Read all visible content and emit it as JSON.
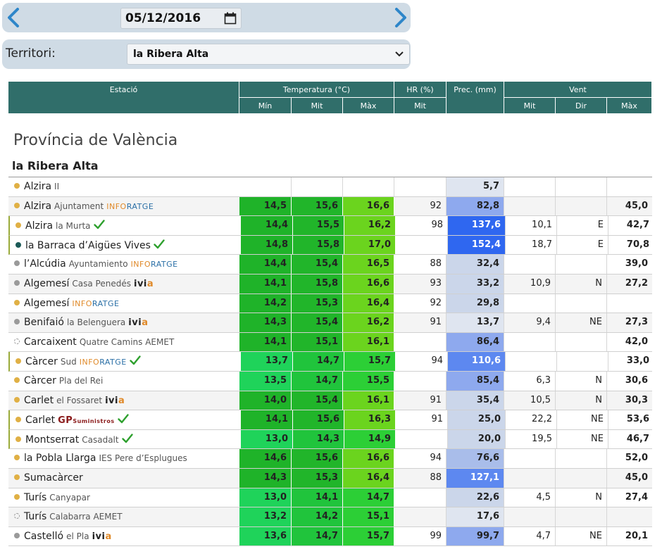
{
  "date": "05/12/2016",
  "territori": {
    "label": "Territori:",
    "selected": "la Ribera Alta"
  },
  "table_header": {
    "estacio": "Estació",
    "temperatura": "Temperatura (°C)",
    "hr": "HR (%)",
    "prec": "Prec. (mm)",
    "vent": "Vent",
    "t_min": "Mín",
    "t_mit": "Mit",
    "t_max": "Màx",
    "hr_mit": "Mit",
    "v_mit": "Mit",
    "v_dir": "Dir",
    "v_max": "Màx"
  },
  "province": "Província de València",
  "region": "la Ribera Alta",
  "colors": {
    "header_bg": "#306e6a",
    "bar_bg": "#cfdbe5",
    "prec_scale": [
      "#d7e0ef",
      "#aebfe3",
      "#7c9cec",
      "#3c74ee",
      "#1a56f0"
    ]
  },
  "rows": [
    {
      "dot": "y",
      "name": "Alzira",
      "sub": "II",
      "badge": "",
      "check": false,
      "hl": false,
      "min": "",
      "mit": "",
      "max": "",
      "hr": "",
      "prec": "5,7",
      "vmit": "",
      "vdir": "",
      "vmax": ""
    },
    {
      "dot": "y",
      "name": "Alzira",
      "sub": "Ajuntament",
      "badge": "info",
      "check": false,
      "hl": false,
      "min": "14,5",
      "mit": "15,6",
      "max": "16,6",
      "hr": "92",
      "prec": "82,8",
      "vmit": "",
      "vdir": "",
      "vmax": "45,0"
    },
    {
      "dot": "y",
      "name": "Alzira",
      "sub": "la Murta",
      "badge": "",
      "check": true,
      "hl": true,
      "min": "14,4",
      "mit": "15,5",
      "max": "16,2",
      "hr": "98",
      "prec": "137,6",
      "vmit": "10,1",
      "vdir": "E",
      "vmax": "42,7"
    },
    {
      "dot": "d",
      "name": "la Barraca d’Aigües Vives",
      "sub": "",
      "badge": "",
      "check": true,
      "hl": true,
      "min": "14,8",
      "mit": "15,8",
      "max": "17,0",
      "hr": "",
      "prec": "152,4",
      "vmit": "18,7",
      "vdir": "E",
      "vmax": "70,8"
    },
    {
      "dot": "g",
      "name": "l’Alcúdia",
      "sub": "Ayuntamiento",
      "badge": "info",
      "check": false,
      "hl": false,
      "min": "14,4",
      "mit": "15,4",
      "max": "16,5",
      "hr": "88",
      "prec": "32,4",
      "vmit": "",
      "vdir": "",
      "vmax": "39,0"
    },
    {
      "dot": "g",
      "name": "Algemesí",
      "sub": "Casa Penedés",
      "badge": "ivia",
      "check": false,
      "hl": false,
      "min": "14,1",
      "mit": "15,8",
      "max": "16,6",
      "hr": "93",
      "prec": "33,2",
      "vmit": "10,9",
      "vdir": "N",
      "vmax": "27,2"
    },
    {
      "dot": "y",
      "name": "Algemesí",
      "sub": "",
      "badge": "info",
      "check": false,
      "hl": false,
      "min": "14,2",
      "mit": "15,3",
      "max": "16,4",
      "hr": "92",
      "prec": "29,8",
      "vmit": "",
      "vdir": "",
      "vmax": ""
    },
    {
      "dot": "g",
      "name": "Benifaió",
      "sub": "la Belenguera",
      "badge": "ivia",
      "check": false,
      "hl": false,
      "min": "14,3",
      "mit": "15,4",
      "max": "16,2",
      "hr": "91",
      "prec": "13,7",
      "vmit": "9,4",
      "vdir": "NE",
      "vmax": "27,3"
    },
    {
      "dot": "e",
      "name": "Carcaixent",
      "sub": "Quatre Camins AEMET",
      "badge": "",
      "check": false,
      "hl": false,
      "min": "14,1",
      "mit": "15,1",
      "max": "16,1",
      "hr": "",
      "prec": "86,4",
      "vmit": "",
      "vdir": "",
      "vmax": "42,0"
    },
    {
      "dot": "y",
      "name": "Càrcer",
      "sub": "Sud",
      "badge": "info",
      "check": true,
      "hl": true,
      "min": "13,7",
      "mit": "14,7",
      "max": "15,7",
      "hr": "94",
      "prec": "110,6",
      "vmit": "",
      "vdir": "",
      "vmax": "33,0"
    },
    {
      "dot": "y",
      "name": "Càrcer",
      "sub": "Pla del Rei",
      "badge": "",
      "check": false,
      "hl": false,
      "min": "13,5",
      "mit": "14,7",
      "max": "15,5",
      "hr": "",
      "prec": "85,4",
      "vmit": "6,3",
      "vdir": "N",
      "vmax": "30,6"
    },
    {
      "dot": "y",
      "name": "Carlet",
      "sub": "el Fossaret",
      "badge": "ivia",
      "check": false,
      "hl": false,
      "min": "14,0",
      "mit": "15,4",
      "max": "16,1",
      "hr": "91",
      "prec": "35,4",
      "vmit": "10,5",
      "vdir": "N",
      "vmax": "30,3"
    },
    {
      "dot": "y",
      "name": "Carlet",
      "sub": "",
      "badge": "gp",
      "check": true,
      "hl": true,
      "min": "14,1",
      "mit": "15,6",
      "max": "16,3",
      "hr": "91",
      "prec": "25,0",
      "vmit": "22,2",
      "vdir": "NE",
      "vmax": "53,6"
    },
    {
      "dot": "y",
      "name": "Montserrat",
      "sub": "Casadalt",
      "badge": "",
      "check": true,
      "hl": true,
      "min": "13,0",
      "mit": "14,3",
      "max": "14,9",
      "hr": "",
      "prec": "20,0",
      "vmit": "19,5",
      "vdir": "NE",
      "vmax": "46,7"
    },
    {
      "dot": "y",
      "name": "la Pobla Llarga",
      "sub": "IES Pere d’Esplugues",
      "badge": "",
      "check": false,
      "hl": false,
      "min": "14,6",
      "mit": "15,6",
      "max": "16,6",
      "hr": "94",
      "prec": "76,6",
      "vmit": "",
      "vdir": "",
      "vmax": "52,0"
    },
    {
      "dot": "y",
      "name": "Sumacàrcer",
      "sub": "",
      "badge": "",
      "check": false,
      "hl": false,
      "min": "14,3",
      "mit": "15,3",
      "max": "16,4",
      "hr": "88",
      "prec": "127,1",
      "vmit": "",
      "vdir": "",
      "vmax": "45,0"
    },
    {
      "dot": "y",
      "name": "Turís",
      "sub": "Canyapar",
      "badge": "",
      "check": false,
      "hl": false,
      "min": "13,0",
      "mit": "14,1",
      "max": "14,7",
      "hr": "",
      "prec": "22,6",
      "vmit": "4,5",
      "vdir": "N",
      "vmax": "27,4"
    },
    {
      "dot": "e",
      "name": "Turís",
      "sub": "Calabarra AEMET",
      "badge": "",
      "check": false,
      "hl": false,
      "min": "13,2",
      "mit": "14,2",
      "max": "15,1",
      "hr": "",
      "prec": "17,6",
      "vmit": "",
      "vdir": "",
      "vmax": ""
    },
    {
      "dot": "g",
      "name": "Castelló",
      "sub": "el Pla",
      "badge": "ivia",
      "check": false,
      "hl": false,
      "min": "13,6",
      "mit": "14,7",
      "max": "15,7",
      "hr": "99",
      "prec": "99,7",
      "vmit": "4,7",
      "vdir": "NE",
      "vmax": "20,1"
    }
  ],
  "badges": {
    "info_a": "INFO",
    "info_b": "RATGE",
    "ivia_a": "ivi",
    "ivia_b": "a",
    "gp_a": "GP",
    "gp_b": "Suministros"
  }
}
